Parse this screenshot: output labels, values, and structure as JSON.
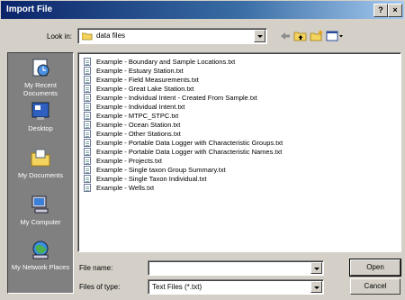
{
  "window": {
    "title": "Import File",
    "help_label": "?",
    "close_label": "×"
  },
  "toolbar": {
    "look_in_label": "Look in:",
    "look_in_value": "data files"
  },
  "places": [
    {
      "label": "My Recent Documents",
      "icon": "recent-documents-icon"
    },
    {
      "label": "Desktop",
      "icon": "desktop-icon"
    },
    {
      "label": "My Documents",
      "icon": "my-documents-icon"
    },
    {
      "label": "My Computer",
      "icon": "my-computer-icon"
    },
    {
      "label": "My Network Places",
      "icon": "network-places-icon"
    }
  ],
  "files": [
    "Example - Boundary and Sample Locations.txt",
    "Example - Estuary Station.txt",
    "Example - Field Measurements.txt",
    "Example - Great Lake Station.txt",
    "Example - Individual Intent - Created From Sample.txt",
    "Example - Individual Intent.txt",
    "Example - MTPC_STPC.txt",
    "Example - Ocean Station.txt",
    "Example - Other Stations.txt",
    "Example - Portable Data Logger with Characteristic Groups.txt",
    "Example - Portable Data Logger with Characteristic Names.txt",
    "Example - Projects.txt",
    "Example - Single taxon Group Summary.txt",
    "Example - Single Taxon Individual.txt",
    "Example - Wells.txt"
  ],
  "footer": {
    "file_name_label": "File name:",
    "file_name_value": "",
    "file_type_label": "Files of type:",
    "file_type_value": "Text Files (*.txt)",
    "open_label": "Open",
    "cancel_label": "Cancel"
  }
}
